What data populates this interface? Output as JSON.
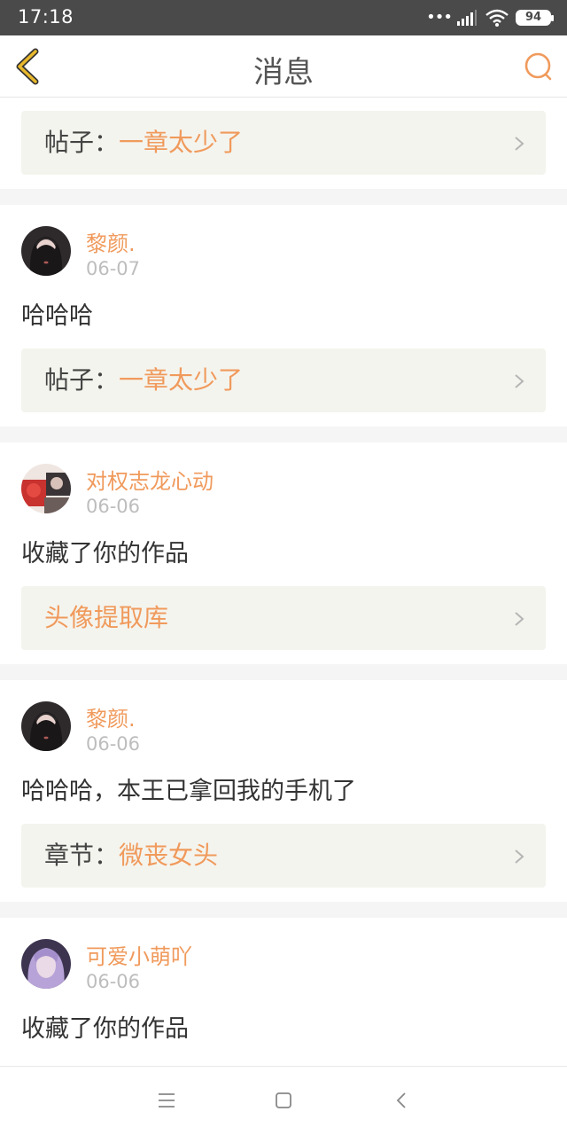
{
  "status_bar": {
    "time": "17:18",
    "dots": "•••",
    "battery": "94"
  },
  "header": {
    "title": "消息"
  },
  "colors": {
    "accent": "#f09a5c",
    "header_back_icon": "#e8b82c",
    "card_bg": "#f4f4ee"
  },
  "messages": [
    {
      "partial": true,
      "ref": {
        "label": "帖子：",
        "title": "一章太少了"
      }
    },
    {
      "user": "黎颜.",
      "date": "06-07",
      "text": "哈哈哈",
      "avatar": "girl-dark-hair-avatar",
      "ref": {
        "label": "帖子：",
        "title": "一章太少了"
      }
    },
    {
      "user": "对权志龙心动",
      "date": "06-06",
      "text": "收藏了你的作品",
      "avatar": "red-collage-avatar",
      "ref": {
        "label": "",
        "title": "头像提取库"
      }
    },
    {
      "user": "黎颜.",
      "date": "06-06",
      "text": "哈哈哈，本王已拿回我的手机了",
      "avatar": "girl-dark-hair-avatar",
      "ref": {
        "label": "章节：",
        "title": "微丧女头"
      }
    },
    {
      "user": "可爱小萌吖",
      "date": "06-06",
      "text": "收藏了你的作品",
      "avatar": "purple-hair-avatar"
    }
  ],
  "nav_bar": {
    "icons": [
      "menu-icon",
      "home-square-icon",
      "back-triangle-icon"
    ]
  }
}
